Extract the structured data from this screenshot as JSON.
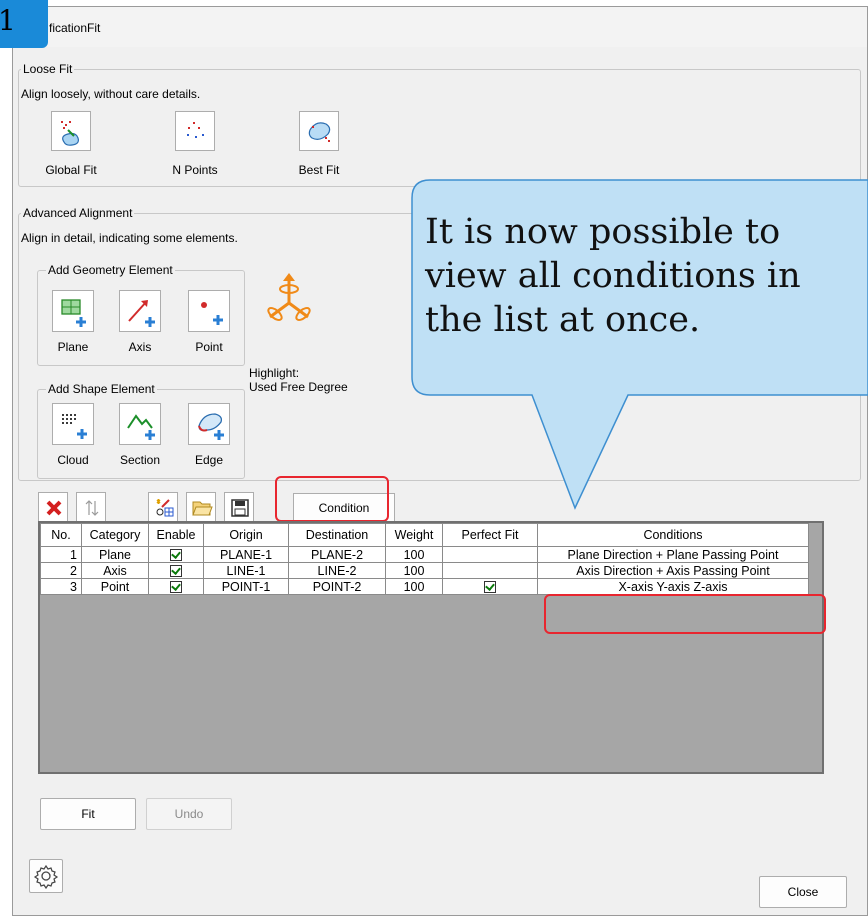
{
  "window": {
    "title": "ficationFit",
    "step_badge": "1"
  },
  "loose_fit": {
    "group_label": "Loose Fit",
    "description": "Align loosely, without care details.",
    "buttons": [
      {
        "label": "Global Fit",
        "icon": "global-fit-icon"
      },
      {
        "label": "N Points",
        "icon": "n-points-icon"
      },
      {
        "label": "Best Fit",
        "icon": "best-fit-icon"
      }
    ]
  },
  "advanced": {
    "group_label": "Advanced Alignment",
    "description": "Align in detail, indicating some elements.",
    "geometry_group_label": "Add Geometry Element",
    "geometry_buttons": [
      {
        "label": "Plane",
        "icon": "plane-add-icon"
      },
      {
        "label": "Axis",
        "icon": "axis-add-icon"
      },
      {
        "label": "Point",
        "icon": "point-add-icon"
      }
    ],
    "shape_group_label": "Add Shape Element",
    "shape_buttons": [
      {
        "label": "Cloud",
        "icon": "cloud-add-icon"
      },
      {
        "label": "Section",
        "icon": "section-add-icon"
      },
      {
        "label": "Edge",
        "icon": "edge-add-icon"
      }
    ],
    "highlight_line1": "Highlight:",
    "highlight_line2": "Used Free Degree"
  },
  "toolbar": {
    "condition_label": "Condition"
  },
  "table": {
    "columns": [
      "No.",
      "Category",
      "Enable",
      "Origin",
      "Destination",
      "Weight",
      "Perfect Fit",
      "Conditions"
    ],
    "rows": [
      {
        "no": "1",
        "category": "Plane",
        "enable": true,
        "origin": "PLANE-1",
        "destination": "PLANE-2",
        "weight": "100",
        "perfect_fit": false,
        "conditions": "Plane Direction + Plane Passing Point"
      },
      {
        "no": "2",
        "category": "Axis",
        "enable": true,
        "origin": "LINE-1",
        "destination": "LINE-2",
        "weight": "100",
        "perfect_fit": false,
        "conditions": "Axis Direction + Axis Passing Point"
      },
      {
        "no": "3",
        "category": "Point",
        "enable": true,
        "origin": "POINT-1",
        "destination": "POINT-2",
        "weight": "100",
        "perfect_fit": true,
        "conditions": "X-axis Y-axis Z-axis"
      }
    ]
  },
  "footer": {
    "fit_label": "Fit",
    "undo_label": "Undo",
    "close_label": "Close"
  },
  "callout": {
    "line1": "It is now possible to",
    "line2": "view all conditions in",
    "line3": "the list at once."
  },
  "colors": {
    "accent": "#1a8ad8",
    "highlight": "#e8262f",
    "callout_fill": "#bfe0f5",
    "callout_border": "#3e8fd0"
  }
}
